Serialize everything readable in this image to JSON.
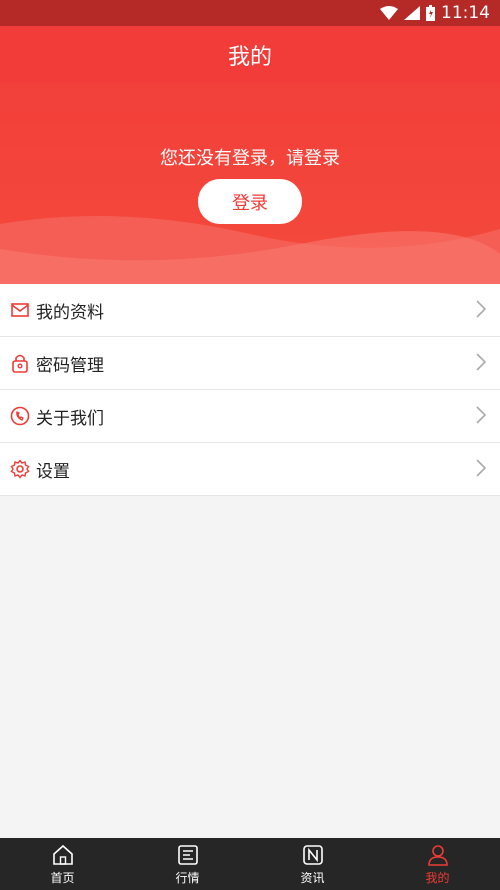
{
  "status": {
    "time": "11:14"
  },
  "header": {
    "title": "我的",
    "login_prompt": "您还没有登录，请登录",
    "login_button": "登录"
  },
  "menu": [
    {
      "label": "我的资料",
      "icon": "mail-icon"
    },
    {
      "label": "密码管理",
      "icon": "lock-icon"
    },
    {
      "label": "关于我们",
      "icon": "phone-icon"
    },
    {
      "label": "设置",
      "icon": "gear-icon"
    }
  ],
  "tabs": [
    {
      "label": "首页",
      "icon": "home-icon",
      "active": false
    },
    {
      "label": "行情",
      "icon": "market-icon",
      "active": false
    },
    {
      "label": "资讯",
      "icon": "news-icon",
      "active": false
    },
    {
      "label": "我的",
      "icon": "user-icon",
      "active": true
    }
  ],
  "colors": {
    "accent": "#ef3b35",
    "header": "#f23c39",
    "tabbar": "#262626"
  }
}
